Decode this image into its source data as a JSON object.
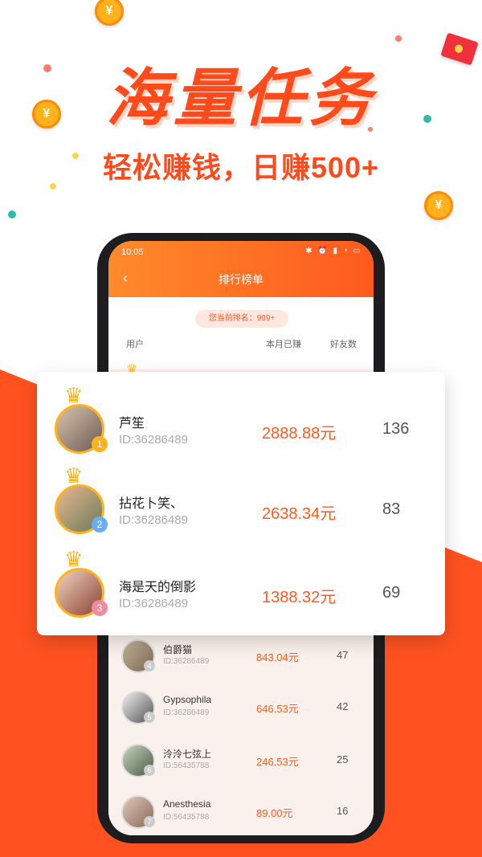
{
  "headline": "海量任务",
  "subline": "轻松赚钱，日赚500+",
  "coin_symbol": "¥",
  "colors": {
    "accent": "#ff4a1c",
    "gold": "#ffb21e"
  },
  "phone": {
    "time": "10:05",
    "status_icons": "✱ ⏰ ▮ ◔ ▭",
    "back": "‹",
    "title": "排行榜单",
    "my_rank": "您当前排名：999+",
    "col_user": "用户",
    "col_earned": "本月已赚",
    "col_friends": "好友数",
    "list": [
      {
        "rank": "4",
        "name": "伯爵猫",
        "id": "ID:36286489",
        "amount": "843.04元",
        "friends": "47"
      },
      {
        "rank": "5",
        "name": "Gypsophila",
        "id": "ID:36286489",
        "amount": "646.53元",
        "friends": "42"
      },
      {
        "rank": "6",
        "name": "泠泠七弦上",
        "id": "ID:56435788",
        "amount": "246.53元",
        "friends": "25"
      },
      {
        "rank": "7",
        "name": "Anesthesia",
        "id": "ID:56435788",
        "amount": "89.00元",
        "friends": "16"
      }
    ]
  },
  "top3": [
    {
      "rank": "1",
      "name": "芦笙",
      "id": "ID:36286489",
      "amount": "2888.88元",
      "friends": "136",
      "badge_color": "#ffb21e"
    },
    {
      "rank": "2",
      "name": "拈花卜笑、",
      "id": "ID:36286489",
      "amount": "2638.34元",
      "friends": "83",
      "badge_color": "#6aaef0"
    },
    {
      "rank": "3",
      "name": "海是天的倒影",
      "id": "ID:36286489",
      "amount": "1388.32元",
      "friends": "69",
      "badge_color": "#f08aa0"
    }
  ]
}
